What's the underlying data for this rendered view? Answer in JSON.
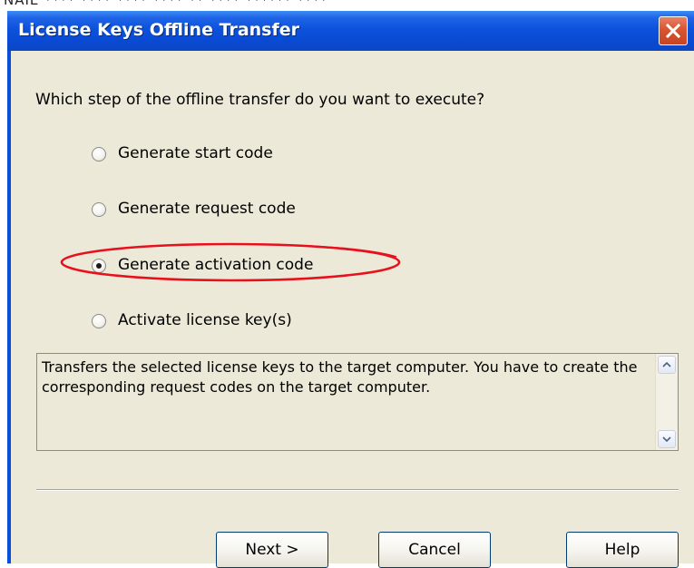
{
  "background": {
    "partial_text": "NAIE  ****  ****  ****  ****  **  ****  ******  ****"
  },
  "window": {
    "title": "License Keys Offline Transfer",
    "close_icon": "close-icon"
  },
  "dialog": {
    "question": "Which step of the offline transfer do you want to execute?",
    "options": [
      {
        "label": "Generate start code",
        "selected": false
      },
      {
        "label": "Generate request code",
        "selected": false
      },
      {
        "label": "Generate activation code",
        "selected": true
      },
      {
        "label": "Activate license key(s)",
        "selected": false
      }
    ],
    "description": "Transfers the selected license keys to the target computer. You have to create the corresponding request codes on the target computer."
  },
  "buttons": {
    "next": "Next >",
    "cancel": "Cancel",
    "help": "Help"
  },
  "colors": {
    "titlebar": "#0a4ad3",
    "dialog_bg": "#ece9d8",
    "highlight_ellipse": "#e8101c",
    "close_button": "#d9542f"
  }
}
